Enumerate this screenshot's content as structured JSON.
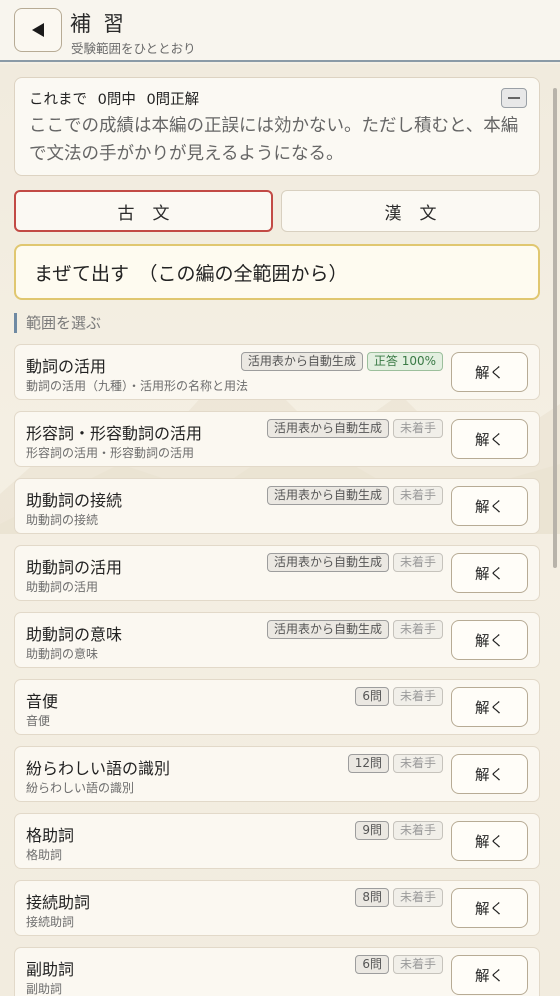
{
  "header": {
    "title": "補習",
    "subtitle": "受験範囲をひととおり"
  },
  "status": {
    "summary": "これまで 0問中 0問正解",
    "note": "ここでの成績は本編の正誤には効かない。ただし積むと、本編で文法の手がかりが見えるようになる。"
  },
  "tabs": [
    {
      "label": "古文",
      "active": true
    },
    {
      "label": "漢文",
      "active": false
    }
  ],
  "mix": {
    "label": "まぜて出す　（この編の全範囲から）"
  },
  "section_label": "範囲を選ぶ",
  "topics": [
    {
      "title": "動詞の活用",
      "sub": "動詞の活用（九種）・活用形の名称と用法",
      "badges": [
        "活用表から自動生成",
        "正答 100%"
      ],
      "badge_styles": [
        "plain",
        "ok"
      ],
      "button": "解く"
    },
    {
      "title": "形容詞・形容動詞の活用",
      "sub": "形容詞の活用・形容動詞の活用",
      "badges": [
        "活用表から自動生成",
        "未着手"
      ],
      "badge_styles": [
        "plain",
        "muted"
      ],
      "button": "解く"
    },
    {
      "title": "助動詞の接続",
      "sub": "助動詞の接続",
      "badges": [
        "活用表から自動生成",
        "未着手"
      ],
      "badge_styles": [
        "plain",
        "muted"
      ],
      "button": "解く"
    },
    {
      "title": "助動詞の活用",
      "sub": "助動詞の活用",
      "badges": [
        "活用表から自動生成",
        "未着手"
      ],
      "badge_styles": [
        "plain",
        "muted"
      ],
      "button": "解く"
    },
    {
      "title": "助動詞の意味",
      "sub": "助動詞の意味",
      "badges": [
        "活用表から自動生成",
        "未着手"
      ],
      "badge_styles": [
        "plain",
        "muted"
      ],
      "button": "解く"
    },
    {
      "title": "音便",
      "sub": "音便",
      "badges": [
        "6問",
        "未着手"
      ],
      "badge_styles": [
        "plain",
        "muted"
      ],
      "button": "解く"
    },
    {
      "title": "紛らわしい語の識別",
      "sub": "紛らわしい語の識別",
      "badges": [
        "12問",
        "未着手"
      ],
      "badge_styles": [
        "plain",
        "muted"
      ],
      "button": "解く"
    },
    {
      "title": "格助詞",
      "sub": "格助詞",
      "badges": [
        "9問",
        "未着手"
      ],
      "badge_styles": [
        "plain",
        "muted"
      ],
      "button": "解く"
    },
    {
      "title": "接続助詞",
      "sub": "接続助詞",
      "badges": [
        "8問",
        "未着手"
      ],
      "badge_styles": [
        "plain",
        "muted"
      ],
      "button": "解く"
    },
    {
      "title": "副助詞",
      "sub": "副助詞",
      "badges": [
        "6問",
        "未着手"
      ],
      "badge_styles": [
        "plain",
        "muted"
      ],
      "button": "解く"
    }
  ],
  "colors": {
    "active_tab_border": "#c24a45",
    "mix_border": "#e0c770",
    "accent_blue": "#6f8aa3",
    "ok_green": "#3a7a45"
  }
}
